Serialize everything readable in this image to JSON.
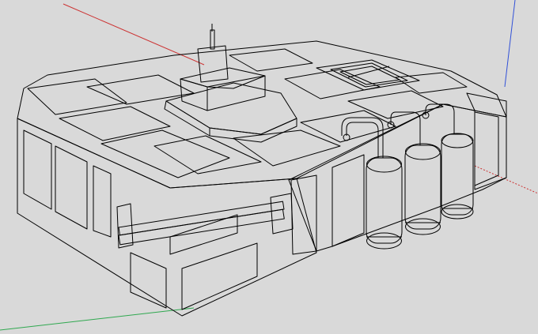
{
  "viewport": {
    "background": "#d9d9d9",
    "subject": "3d-model",
    "axes": {
      "red": "#cc3333",
      "green": "#2fa84f",
      "blue": "#3050d8"
    },
    "palette": {
      "top": "#8e8e8e",
      "top_light": "#9b9b9b",
      "side_front": "#6a6a6a",
      "side_right": "#7a7a7a",
      "dark": "#4d4d4d",
      "edge": "#000000"
    }
  }
}
